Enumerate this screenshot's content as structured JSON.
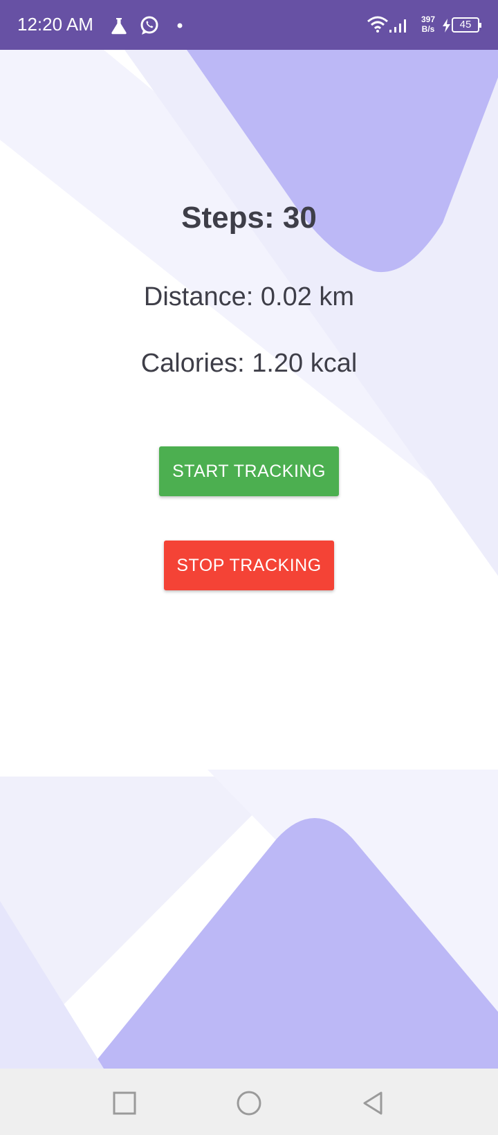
{
  "status_bar": {
    "time": "12:20 AM",
    "net_speed_value": "397",
    "net_speed_unit": "B/s",
    "battery_level": "45",
    "icons": [
      "flask-icon",
      "whatsapp-icon",
      "notification-dot-icon",
      "wifi-icon",
      "signal-icon",
      "charging-icon",
      "battery-icon"
    ],
    "color": "#6751a4"
  },
  "tracker": {
    "steps_text": "Steps: 30",
    "distance_text": "Distance: 0.02 km",
    "calories_text": "Calories: 1.20 kcal"
  },
  "buttons": {
    "start_label": "START TRACKING",
    "start_color": "#4caf50",
    "stop_label": "STOP TRACKING",
    "stop_color": "#f44336"
  },
  "nav_bar": {
    "icons": [
      "recent-apps-icon",
      "home-icon",
      "back-icon"
    ]
  }
}
